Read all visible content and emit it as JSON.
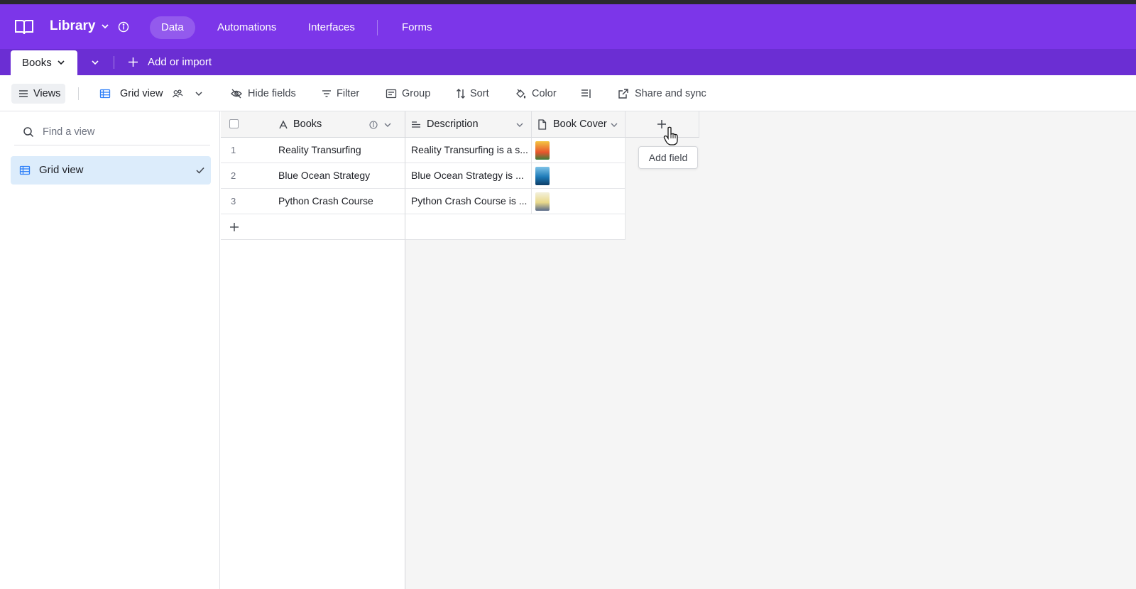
{
  "app": {
    "base_name": "Library",
    "nav_tabs": [
      {
        "label": "Data"
      },
      {
        "label": "Automations"
      },
      {
        "label": "Interfaces"
      },
      {
        "label": "Forms"
      }
    ]
  },
  "tables": {
    "active_table": "Books",
    "add_or_import": "Add or import"
  },
  "toolbar": {
    "views": "Views",
    "view_name": "Grid view",
    "hide_fields": "Hide fields",
    "filter": "Filter",
    "group": "Group",
    "sort": "Sort",
    "color": "Color",
    "share_and_sync": "Share and sync"
  },
  "sidebar": {
    "search_placeholder": "Find a view",
    "views": [
      {
        "label": "Grid view",
        "selected": true
      }
    ]
  },
  "grid": {
    "columns": [
      "Books",
      "Description",
      "Book Cover"
    ],
    "rows": [
      {
        "num": "1",
        "book": "Reality Transurfing",
        "description": "Reality Transurfing is a s...",
        "cover_color": "#e8552d"
      },
      {
        "num": "2",
        "book": "Blue Ocean Strategy",
        "description": "Blue Ocean Strategy is ...",
        "cover_color": "#1e7bb8"
      },
      {
        "num": "3",
        "book": "Python Crash Course",
        "description": "Python Crash Course is ...",
        "cover_color": "#e9d98a"
      }
    ],
    "add_field_tooltip": "Add field"
  },
  "colors": {
    "appbar": "#7c36e9",
    "tablebar": "#6b2ed3",
    "selected_view": "#dcecfb"
  }
}
